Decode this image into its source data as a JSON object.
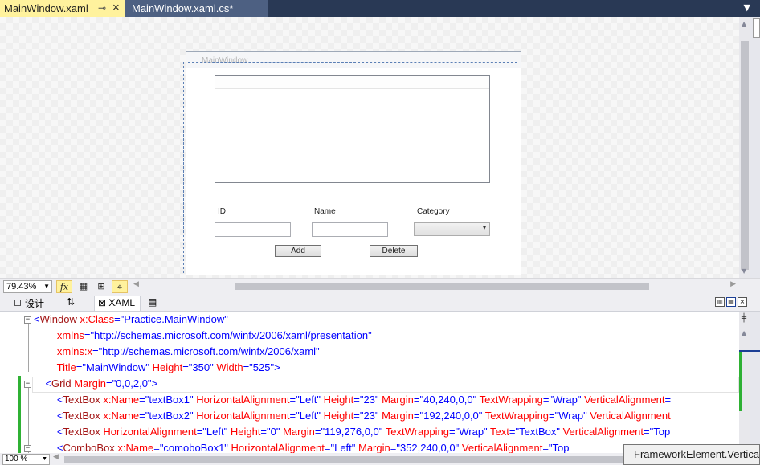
{
  "tabs": [
    {
      "label": "MainWindow.xaml",
      "active": true
    },
    {
      "label": "MainWindow.xaml.cs*",
      "active": false
    }
  ],
  "tab_icons": {
    "pin": "pin-icon",
    "close": "close-icon",
    "overflow": "chevron-down-icon"
  },
  "designer": {
    "window_title": "MainWindow",
    "labels": {
      "id": "ID",
      "name": "Name",
      "category": "Category"
    },
    "buttons": {
      "add": "Add",
      "delete": "Delete"
    }
  },
  "zoom": {
    "value": "79.43%"
  },
  "toolbar": {
    "fx": "fx"
  },
  "split_tabs": {
    "design": "设计",
    "swap": "⇅",
    "xaml": "XAML"
  },
  "code": {
    "lines": [
      {
        "segments": [
          {
            "t": "<",
            "c": "punc"
          },
          {
            "t": "Window",
            "c": "tag"
          },
          {
            "t": " x:Class",
            "c": "attr"
          },
          {
            "t": "=",
            "c": "punc"
          },
          {
            "t": "\"Practice.MainWindow\"",
            "c": "val"
          }
        ]
      },
      {
        "segments": [
          {
            "t": "        xmlns",
            "c": "attr"
          },
          {
            "t": "=",
            "c": "punc"
          },
          {
            "t": "\"http://schemas.microsoft.com/winfx/2006/xaml/presentation\"",
            "c": "val"
          }
        ]
      },
      {
        "segments": [
          {
            "t": "        xmlns:x",
            "c": "attr"
          },
          {
            "t": "=",
            "c": "punc"
          },
          {
            "t": "\"http://schemas.microsoft.com/winfx/2006/xaml\"",
            "c": "val"
          }
        ]
      },
      {
        "segments": [
          {
            "t": "        Title",
            "c": "attr"
          },
          {
            "t": "=",
            "c": "punc"
          },
          {
            "t": "\"MainWindow\"",
            "c": "val"
          },
          {
            "t": " Height",
            "c": "attr"
          },
          {
            "t": "=",
            "c": "punc"
          },
          {
            "t": "\"350\"",
            "c": "val"
          },
          {
            "t": " Width",
            "c": "attr"
          },
          {
            "t": "=",
            "c": "punc"
          },
          {
            "t": "\"525\"",
            "c": "val"
          },
          {
            "t": ">",
            "c": "punc"
          }
        ]
      },
      {
        "segments": [
          {
            "t": "    <",
            "c": "punc"
          },
          {
            "t": "Grid",
            "c": "tag"
          },
          {
            "t": " Margin",
            "c": "attr"
          },
          {
            "t": "=",
            "c": "punc"
          },
          {
            "t": "\"0,0,2,0\"",
            "c": "val"
          },
          {
            "t": ">",
            "c": "punc"
          }
        ]
      },
      {
        "segments": [
          {
            "t": "        <",
            "c": "punc"
          },
          {
            "t": "TextBox",
            "c": "tag"
          },
          {
            "t": " x:Name",
            "c": "attr"
          },
          {
            "t": "=",
            "c": "punc"
          },
          {
            "t": "\"textBox1\"",
            "c": "val"
          },
          {
            "t": " HorizontalAlignment",
            "c": "attr"
          },
          {
            "t": "=",
            "c": "punc"
          },
          {
            "t": "\"Left\"",
            "c": "val"
          },
          {
            "t": " Height",
            "c": "attr"
          },
          {
            "t": "=",
            "c": "punc"
          },
          {
            "t": "\"23\"",
            "c": "val"
          },
          {
            "t": " Margin",
            "c": "attr"
          },
          {
            "t": "=",
            "c": "punc"
          },
          {
            "t": "\"40,240,0,0\"",
            "c": "val"
          },
          {
            "t": " TextWrapping",
            "c": "attr"
          },
          {
            "t": "=",
            "c": "punc"
          },
          {
            "t": "\"Wrap\"",
            "c": "val"
          },
          {
            "t": " VerticalAlignment",
            "c": "attr"
          },
          {
            "t": "=",
            "c": "punc"
          }
        ]
      },
      {
        "segments": [
          {
            "t": "        <",
            "c": "punc"
          },
          {
            "t": "TextBox",
            "c": "tag"
          },
          {
            "t": " x:Name",
            "c": "attr"
          },
          {
            "t": "=",
            "c": "punc"
          },
          {
            "t": "\"textBox2\"",
            "c": "val"
          },
          {
            "t": " HorizontalAlignment",
            "c": "attr"
          },
          {
            "t": "=",
            "c": "punc"
          },
          {
            "t": "\"Left\"",
            "c": "val"
          },
          {
            "t": " Height",
            "c": "attr"
          },
          {
            "t": "=",
            "c": "punc"
          },
          {
            "t": "\"23\"",
            "c": "val"
          },
          {
            "t": " Margin",
            "c": "attr"
          },
          {
            "t": "=",
            "c": "punc"
          },
          {
            "t": "\"192,240,0,0\"",
            "c": "val"
          },
          {
            "t": " TextWrapping",
            "c": "attr"
          },
          {
            "t": "=",
            "c": "punc"
          },
          {
            "t": "\"Wrap\"",
            "c": "val"
          },
          {
            "t": " VerticalAlignment",
            "c": "attr"
          }
        ]
      },
      {
        "segments": [
          {
            "t": "        <",
            "c": "punc"
          },
          {
            "t": "TextBox",
            "c": "tag"
          },
          {
            "t": " HorizontalAlignment",
            "c": "attr"
          },
          {
            "t": "=",
            "c": "punc"
          },
          {
            "t": "\"Left\"",
            "c": "val"
          },
          {
            "t": " Height",
            "c": "attr"
          },
          {
            "t": "=",
            "c": "punc"
          },
          {
            "t": "\"0\"",
            "c": "val"
          },
          {
            "t": " Margin",
            "c": "attr"
          },
          {
            "t": "=",
            "c": "punc"
          },
          {
            "t": "\"119,276,0,0\"",
            "c": "val"
          },
          {
            "t": " TextWrapping",
            "c": "attr"
          },
          {
            "t": "=",
            "c": "punc"
          },
          {
            "t": "\"Wrap\"",
            "c": "val"
          },
          {
            "t": " Text",
            "c": "attr"
          },
          {
            "t": "=",
            "c": "punc"
          },
          {
            "t": "\"TextBox\"",
            "c": "val"
          },
          {
            "t": " VerticalAlignment",
            "c": "attr"
          },
          {
            "t": "=",
            "c": "punc"
          },
          {
            "t": "\"Top",
            "c": "val"
          }
        ]
      },
      {
        "segments": [
          {
            "t": "        <",
            "c": "punc"
          },
          {
            "t": "ComboBox",
            "c": "tag"
          },
          {
            "t": " x:Name",
            "c": "attr"
          },
          {
            "t": "=",
            "c": "punc"
          },
          {
            "t": "\"comoboBox1\"",
            "c": "val"
          },
          {
            "t": " HorizontalAlignment",
            "c": "attr"
          },
          {
            "t": "=",
            "c": "punc"
          },
          {
            "t": "\"Left\"",
            "c": "val"
          },
          {
            "t": " Margin",
            "c": "attr"
          },
          {
            "t": "=",
            "c": "punc"
          },
          {
            "t": "\"352,240,0,0\"",
            "c": "val"
          },
          {
            "t": " VerticalAlignment",
            "c": "attr"
          },
          {
            "t": "=",
            "c": "punc"
          },
          {
            "t": "\"Top",
            "c": "val"
          }
        ]
      }
    ]
  },
  "tooltip": {
    "text": "FrameworkElement.VerticalAlignment"
  },
  "status": {
    "zoom": "100 %"
  }
}
